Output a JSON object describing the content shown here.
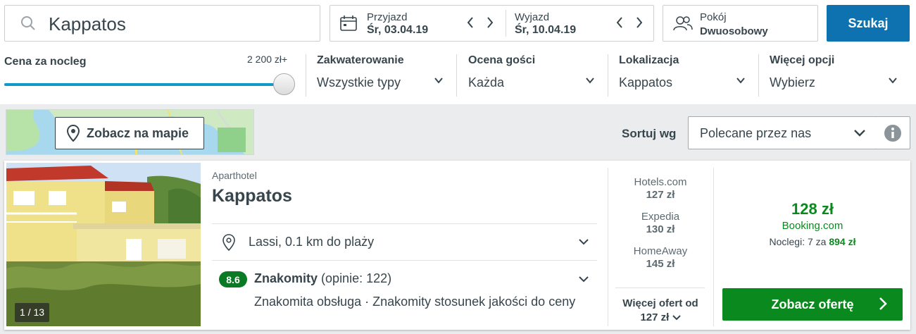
{
  "search": {
    "value": "Kappatos"
  },
  "dates": {
    "checkin_label": "Przyjazd",
    "checkin_value": "Śr, 03.04.19",
    "checkout_label": "Wyjazd",
    "checkout_value": "Śr, 10.04.19"
  },
  "room": {
    "label": "Pokój",
    "value": "Dwuosobowy"
  },
  "search_button": "Szukaj",
  "filters": {
    "price_label": "Cena za nocleg",
    "price_value": "2 200 zł+",
    "price_fraction": 1.0,
    "accommodation": {
      "label": "Zakwaterowanie",
      "value": "Wszystkie typy"
    },
    "rating": {
      "label": "Ocena gości",
      "value": "Każda"
    },
    "location": {
      "label": "Lokalizacja",
      "value": "Kappatos"
    },
    "more": {
      "label": "Więcej opcji",
      "value": "Wybierz"
    }
  },
  "map_button": "Zobacz na mapie",
  "sort": {
    "label": "Sortuj wg",
    "value": "Polecane przez nas"
  },
  "hotel": {
    "type": "Aparthotel",
    "name": "Kappatos",
    "photo_counter": "1 / 13",
    "location": "Lassi, 0.1 km do plaży",
    "rating_score": "8.6",
    "rating_word": "Znakomity",
    "rating_count": "(opinie: 122)",
    "highlights": "Znakomita obsługa · Znakomity stosunek jakości do ceny",
    "offers": [
      {
        "site": "Hotels.com",
        "price": "127 zł"
      },
      {
        "site": "Expedia",
        "price": "130 zł"
      },
      {
        "site": "HomeAway",
        "price": "145 zł"
      }
    ],
    "more_offers_line1": "Więcej ofert od",
    "more_offers_line2": "127 zł",
    "best_price": "128 zł",
    "best_site": "Booking.com",
    "nights_text": "Noclegi: 7 za",
    "nights_total": "894 zł",
    "deal_button": "Zobacz ofertę"
  },
  "colors": {
    "accent": "#0f72b0",
    "deal": "#0a8a1e",
    "slider": "#0f9bc6"
  }
}
